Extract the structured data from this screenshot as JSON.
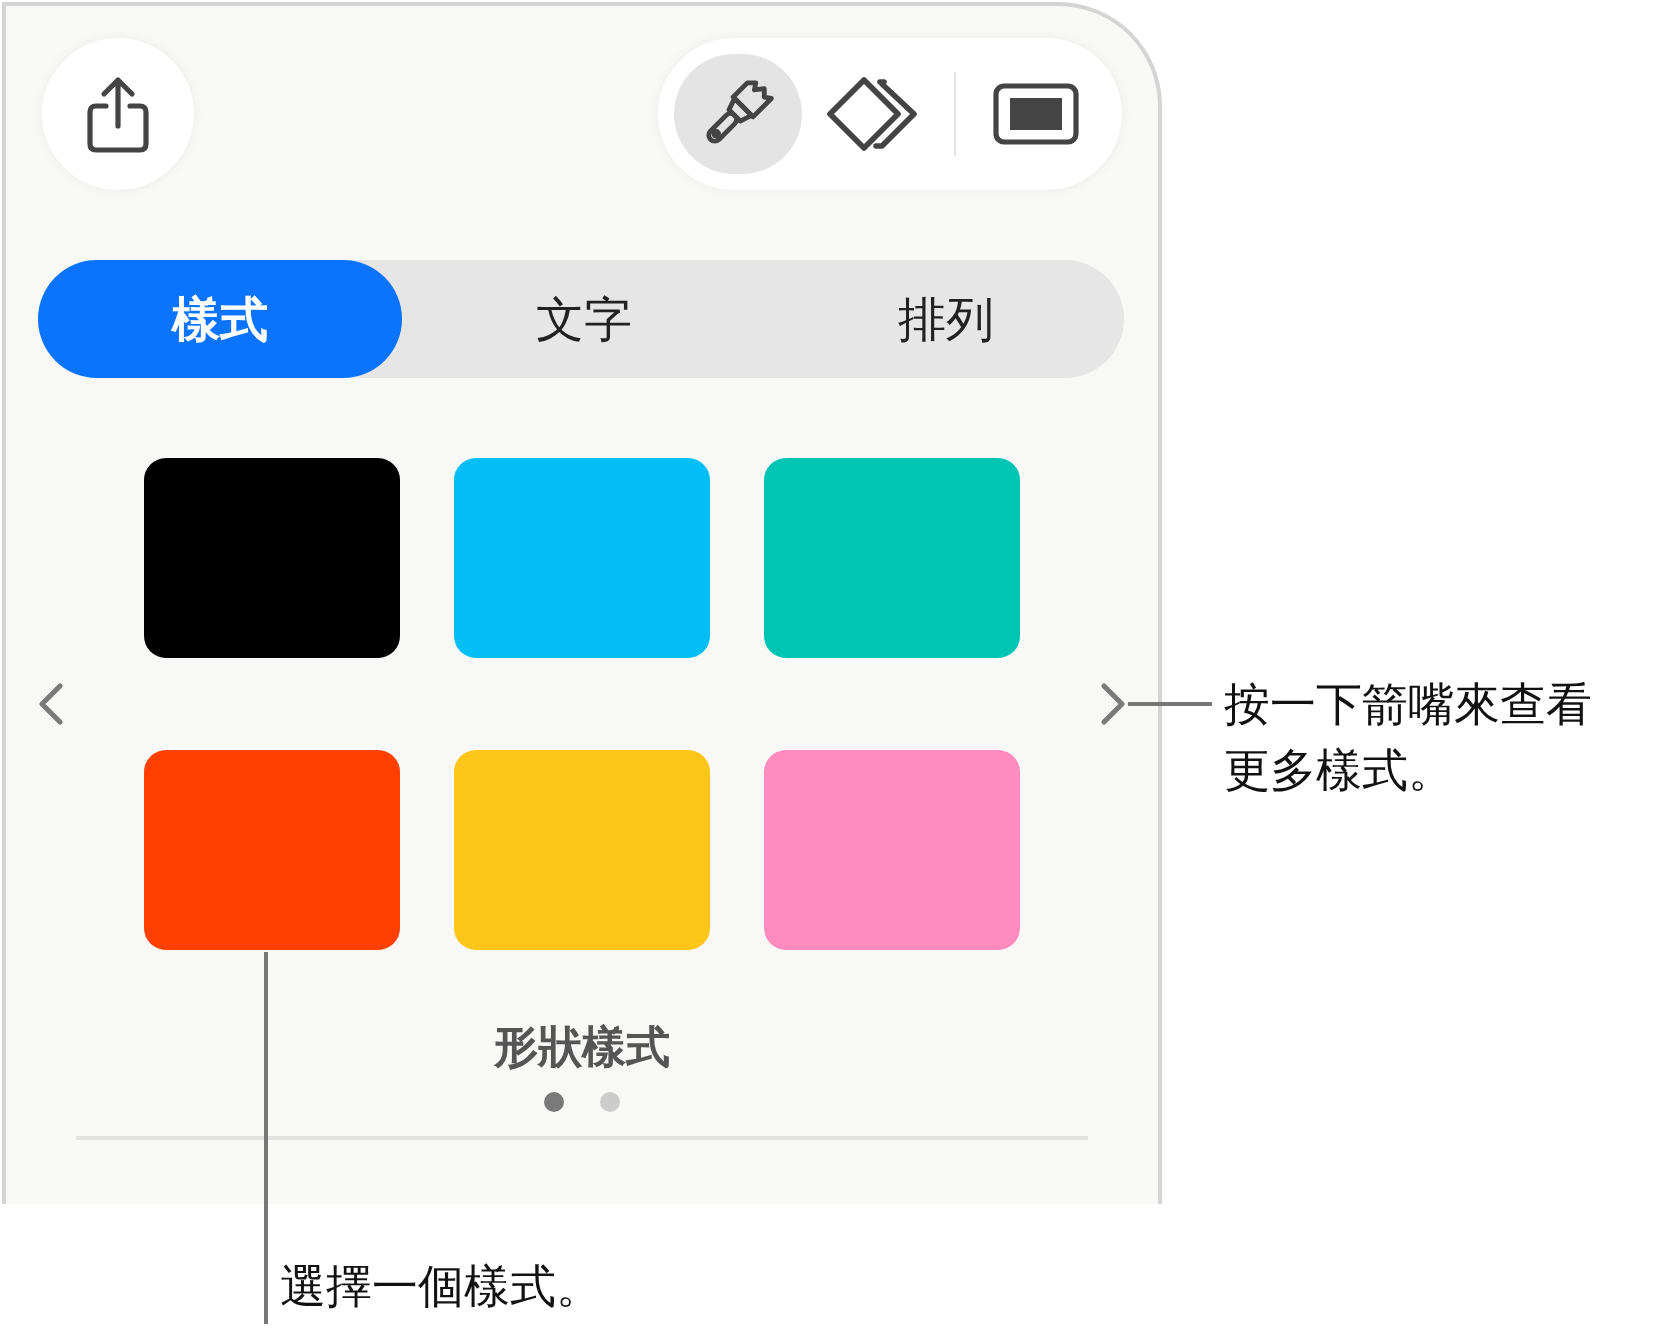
{
  "share_button": {
    "kind": "share"
  },
  "tools": [
    {
      "kind": "brush",
      "selected": true
    },
    {
      "kind": "shapes",
      "selected": false
    },
    {
      "kind": "display",
      "selected": false
    }
  ],
  "tabs": [
    {
      "label": "樣式",
      "selected": true
    },
    {
      "label": "文字",
      "selected": false
    },
    {
      "label": "排列",
      "selected": false
    }
  ],
  "swatches": [
    {
      "color": "#000000"
    },
    {
      "color": "#04bff7"
    },
    {
      "color": "#00c4b4"
    },
    {
      "color": "#ff4000"
    },
    {
      "color": "#fec619"
    },
    {
      "color": "#ff8bbf"
    }
  ],
  "carousel": {
    "title": "形狀樣式",
    "pages": [
      {
        "selected": true
      },
      {
        "selected": false
      }
    ]
  },
  "callouts": [
    {
      "kind": "arrow",
      "text": "按一下箭嘴來查看更多樣式。"
    },
    {
      "kind": "swatch",
      "text": "選擇一個樣式。"
    }
  ]
}
